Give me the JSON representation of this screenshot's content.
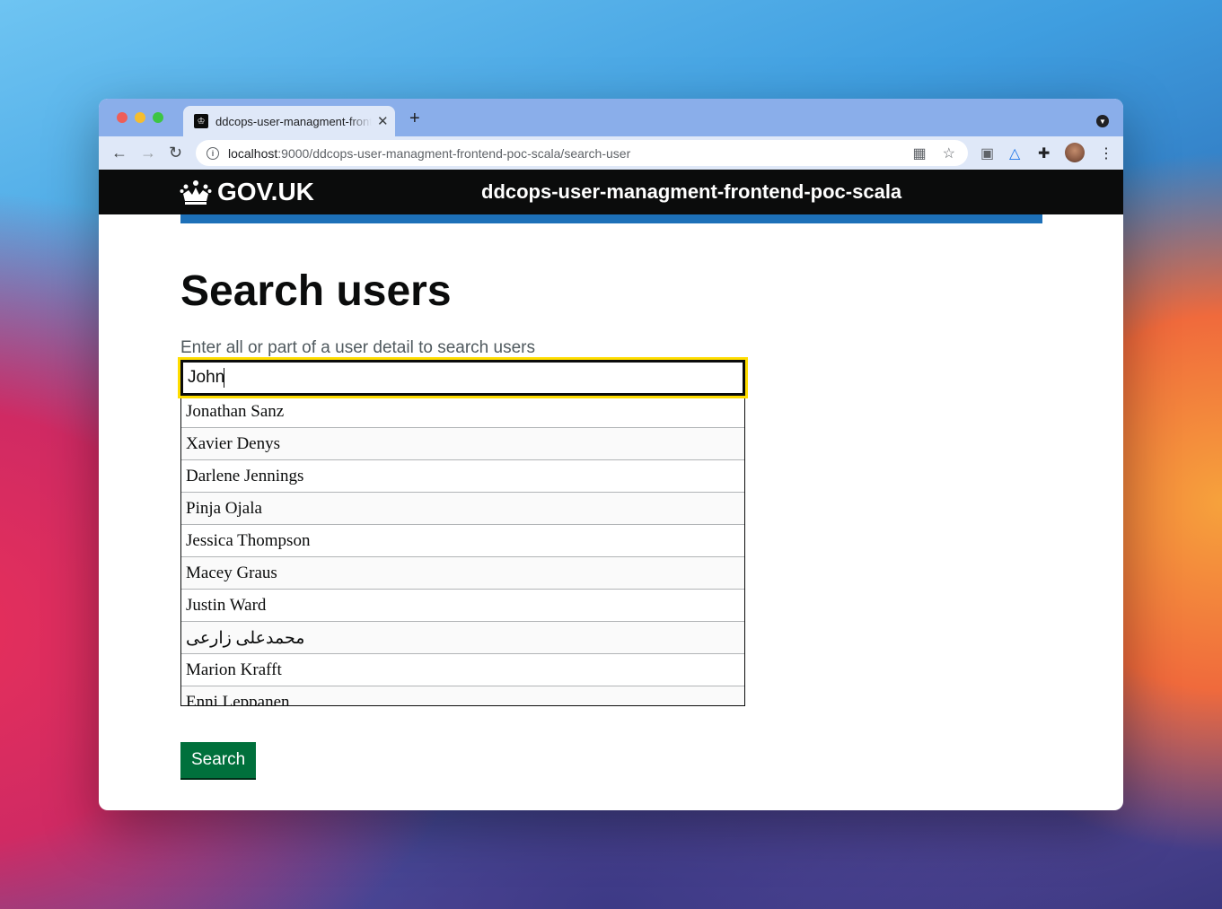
{
  "browser": {
    "tab_title": "ddcops-user-managment-frontend-poc-scala",
    "url_host": "localhost",
    "url_path": ":9000/ddcops-user-managment-frontend-poc-scala/search-user",
    "new_tab_label": "+",
    "close_tab_label": "✕"
  },
  "header": {
    "logo_text": "GOV.UK",
    "service_name": "ddcops-user-managment-frontend-poc-scala"
  },
  "main": {
    "title": "Search users",
    "hint": "Enter all or part of a user detail to search users",
    "search_value": "John",
    "results": [
      "Jonathan Sanz",
      "Xavier Denys",
      "Darlene Jennings",
      "Pinja Ojala",
      "Jessica Thompson",
      "Macey Graus",
      "Justin Ward",
      "محمدعلی زارعی",
      "Marion Krafft",
      "Enni Leppanen"
    ],
    "search_button": "Search"
  },
  "colors": {
    "header_bg": "#0b0c0c",
    "accent_blue": "#1d70b8",
    "focus_yellow": "#ffdd00",
    "button_green": "#00703c"
  }
}
